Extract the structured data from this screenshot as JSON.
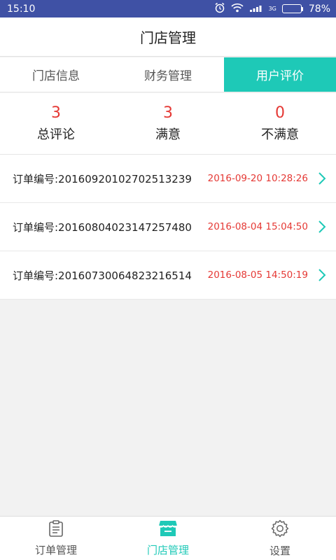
{
  "status_bar": {
    "time": "15:10",
    "network": "3G",
    "battery": "78%",
    "battery_level": 0.78
  },
  "header": {
    "title": "门店管理"
  },
  "tabs": [
    {
      "label": "门店信息",
      "active": false
    },
    {
      "label": "财务管理",
      "active": false
    },
    {
      "label": "用户评价",
      "active": true
    }
  ],
  "stats": [
    {
      "value": "3",
      "label": "总评论"
    },
    {
      "value": "3",
      "label": "满意"
    },
    {
      "value": "0",
      "label": "不满意"
    }
  ],
  "orders": [
    {
      "number": "订单编号:20160920102702513239",
      "time": "2016-09-20 10:28:26"
    },
    {
      "number": "订单编号:20160804023147257480",
      "time": "2016-08-04 15:04:50"
    },
    {
      "number": "订单编号:20160730064823216514",
      "time": "2016-08-05 14:50:19"
    }
  ],
  "bottom_nav": [
    {
      "label": "订单管理",
      "icon": "clipboard-icon",
      "active": false
    },
    {
      "label": "门店管理",
      "icon": "store-icon",
      "active": true
    },
    {
      "label": "设置",
      "icon": "gear-icon",
      "active": false
    }
  ],
  "colors": {
    "accent": "#1ec9b7",
    "status_bar": "#3f51a5",
    "value_red": "#e53935"
  }
}
